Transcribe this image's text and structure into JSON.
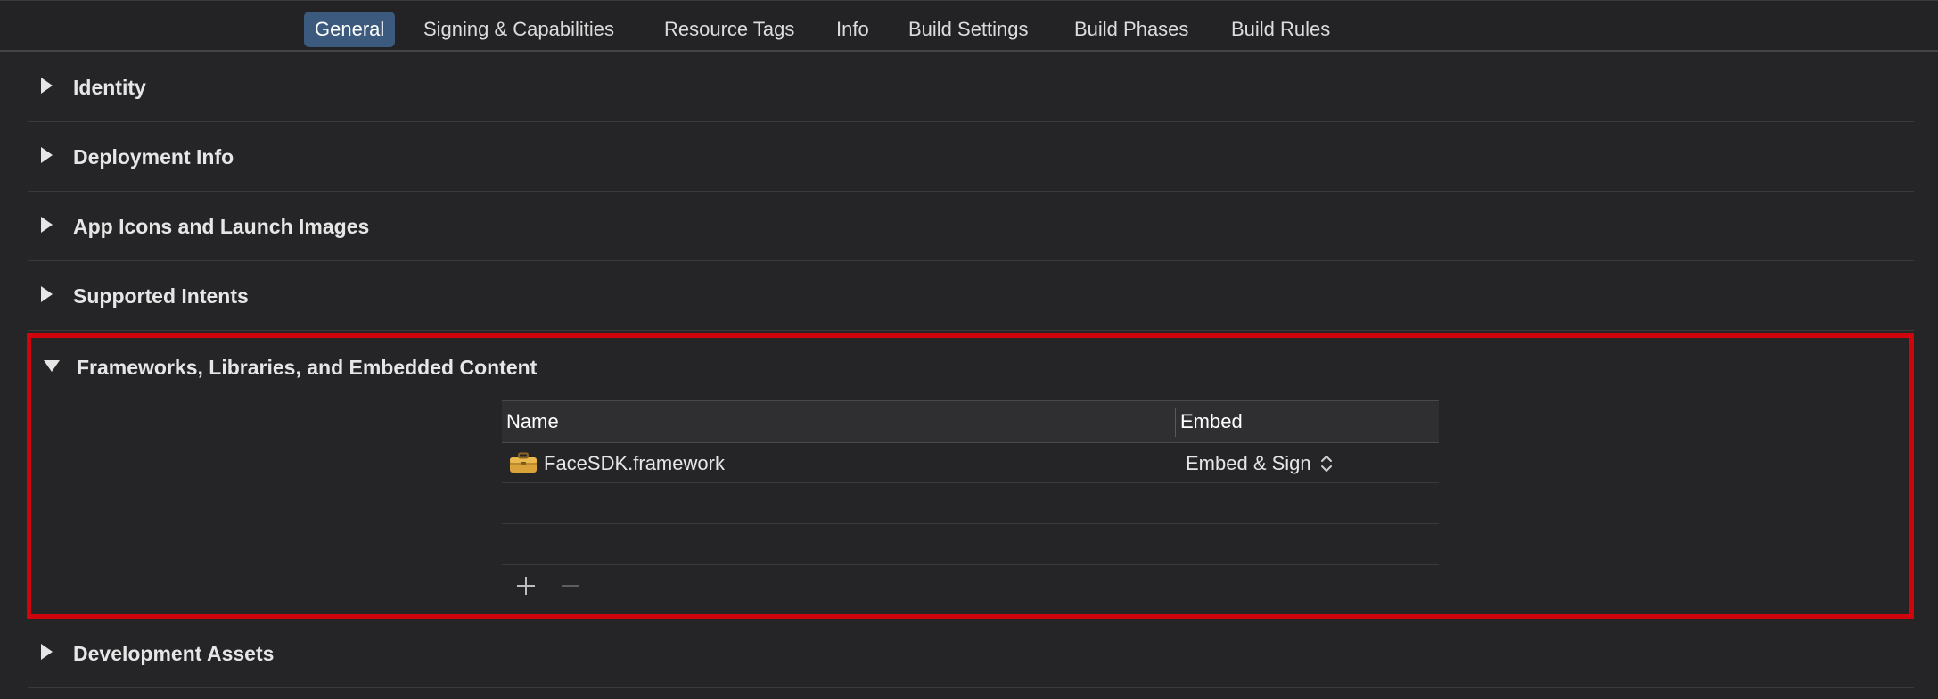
{
  "tabs": [
    {
      "label": "General",
      "active": true
    },
    {
      "label": "Signing & Capabilities",
      "active": false
    },
    {
      "label": "Resource Tags",
      "active": false
    },
    {
      "label": "Info",
      "active": false
    },
    {
      "label": "Build Settings",
      "active": false
    },
    {
      "label": "Build Phases",
      "active": false
    },
    {
      "label": "Build Rules",
      "active": false
    }
  ],
  "sections": {
    "identity": "Identity",
    "deployment_info": "Deployment Info",
    "app_icons": "App Icons and Launch Images",
    "supported_intents": "Supported Intents",
    "frameworks": "Frameworks, Libraries, and Embedded Content",
    "development_assets": "Development Assets"
  },
  "frameworks_table": {
    "columns": {
      "name": "Name",
      "embed": "Embed"
    },
    "rows": [
      {
        "icon": "toolbox-icon",
        "name": "FaceSDK.framework",
        "embed": "Embed & Sign"
      }
    ],
    "add_icon": "plus-icon",
    "remove_icon": "minus-icon"
  },
  "colors": {
    "background": "#252528",
    "active_tab": "#3c5a7e",
    "highlight_border": "#d0040b"
  }
}
